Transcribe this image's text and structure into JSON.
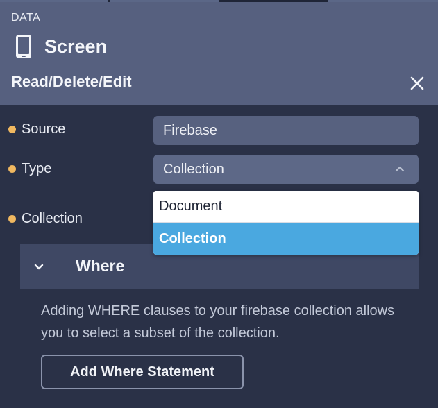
{
  "header": {
    "section_label": "DATA",
    "screen_title": "Screen",
    "mode_title": "Read/Delete/Edit"
  },
  "form": {
    "source": {
      "label": "Source",
      "value": "Firebase"
    },
    "type": {
      "label": "Type",
      "value": "Collection"
    },
    "collection": {
      "label": "Collection"
    }
  },
  "type_dropdown": {
    "options": [
      "Document",
      "Collection"
    ],
    "selected": "Collection"
  },
  "where": {
    "title": "Where",
    "description": "Adding WHERE clauses to your firebase collection allows you to select a subset of the collection.",
    "add_button_label": "Add Where Statement"
  },
  "icons": {
    "screen": "phone-icon",
    "close": "close-icon",
    "type_chevron": "chevron-up-icon",
    "where_chevron": "chevron-down-icon"
  },
  "colors": {
    "header_bg": "#56607f",
    "panel_bg": "#2a3147",
    "required_dot": "#f0b860",
    "selected_option": "#4aa8e0"
  }
}
